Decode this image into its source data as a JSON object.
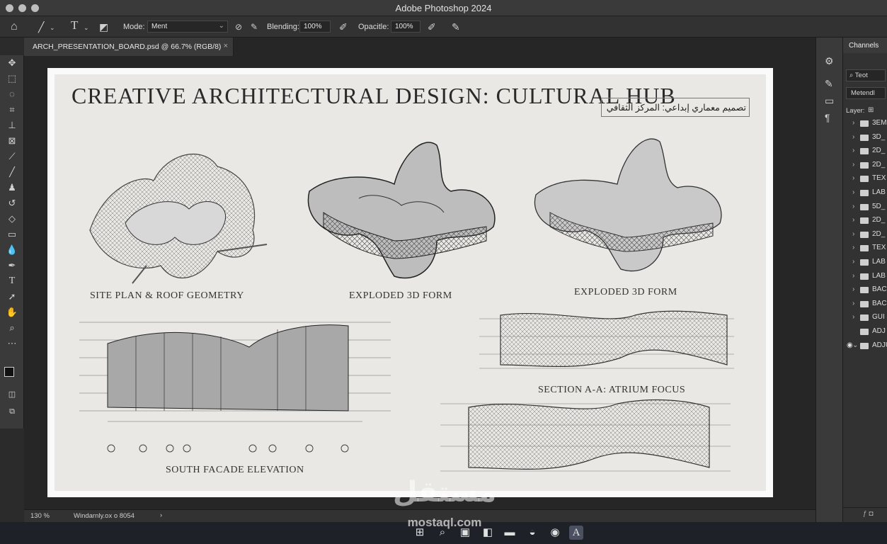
{
  "app": {
    "title": "Adobe Photoshop 2024"
  },
  "options": {
    "mode_label": "Mode:",
    "mode_value": "Ment",
    "blending_label": "Blending:",
    "blending_value": "100%",
    "opacity_label": "Opacitle:",
    "opacity_value": "100%"
  },
  "document": {
    "tab_label": "ARCH_PRESENTATION_BOARD.psd @ 66.7% (RGB/8)",
    "close": "×"
  },
  "board": {
    "title": "CREATIVE ARCHITECTURAL DESIGN: CULTURAL HUB",
    "arabic_title": "تصميم معماري إبداعي: المركز الثقافي",
    "captions": {
      "site_plan": "SITE PLAN & ROOF GEOMETRY",
      "exploded_1": "EXPLODED 3D FORM",
      "exploded_2": "EXPLODED 3D FORM",
      "section": "SECTION A-A: ATRIUM FOCUS",
      "facade": "SOUTH FACADE ELEVATION"
    }
  },
  "status": {
    "zoom": "130 %",
    "info": "Windarnly.ox o 8054",
    "arrow": "›"
  },
  "panel": {
    "tab": "Channels",
    "search": "Teot",
    "blend": "Metendl",
    "layer_label": "Layer:",
    "layers": [
      {
        "name": "3EM",
        "eye": false,
        "chev": "›"
      },
      {
        "name": "3D_",
        "eye": false,
        "chev": "›"
      },
      {
        "name": "2D_",
        "eye": false,
        "chev": "›"
      },
      {
        "name": "2D_",
        "eye": false,
        "chev": "›"
      },
      {
        "name": "TEX",
        "eye": false,
        "chev": "›"
      },
      {
        "name": "LAB",
        "eye": false,
        "chev": "›"
      },
      {
        "name": "5D_",
        "eye": false,
        "chev": "›"
      },
      {
        "name": "2D_",
        "eye": false,
        "chev": "›"
      },
      {
        "name": "2D_",
        "eye": false,
        "chev": "›"
      },
      {
        "name": "TEX",
        "eye": false,
        "chev": "›"
      },
      {
        "name": "LAB",
        "eye": false,
        "chev": "›"
      },
      {
        "name": "LAB",
        "eye": false,
        "chev": "›"
      },
      {
        "name": "BAC",
        "eye": false,
        "chev": "›"
      },
      {
        "name": "BAC",
        "eye": false,
        "chev": "›"
      },
      {
        "name": "GUI",
        "eye": false,
        "chev": "›"
      },
      {
        "name": "ADJ",
        "eye": false,
        "chev": ""
      },
      {
        "name": "ADJU",
        "eye": true,
        "chev": "⌄"
      }
    ]
  },
  "watermark": {
    "logo": "مستقل",
    "site": "mostaql.com"
  },
  "colors": {
    "titlebar": "#3a3a3a",
    "panel": "#323232",
    "canvas_bg": "#262626",
    "paper": "#e9e8e5"
  }
}
